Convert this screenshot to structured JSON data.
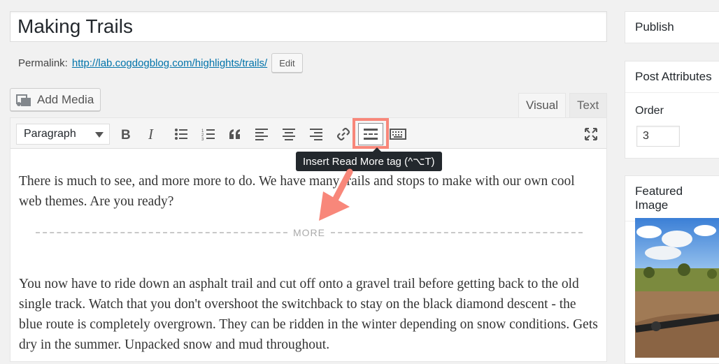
{
  "post": {
    "title": "Making Trails",
    "permalink_label": "Permalink:",
    "permalink_url": "http://lab.cogdogblog.com/highlights/trails/",
    "edit_label": "Edit"
  },
  "media": {
    "add_media_label": "Add Media"
  },
  "editor": {
    "tabs": {
      "visual": "Visual",
      "text": "Text"
    },
    "format_select": "Paragraph",
    "tooltip": "Insert Read More tag (^⌥T)",
    "more_label": "MORE",
    "paragraph1": "There is much to see, and more more to do. We have many trails and stops to make with our own cool web themes. Are you ready?",
    "paragraph2": "You now have to ride down an asphalt trail and cut off onto a gravel trail before getting back to the old single track. Watch that you don't overshoot the switchback to stay on the black diamond descent - the blue route is completely overgrown. They can be ridden in the winter depending on snow conditions. Gets dry in the summer. Unpacked snow and mud throughout."
  },
  "sidebar": {
    "publish_title": "Publish",
    "attributes_title": "Post Attributes",
    "order_label": "Order",
    "order_value": "3",
    "featured_title": "Featured Image"
  },
  "colors": {
    "highlight": "#f8877a",
    "link": "#0073aa",
    "tooltip_bg": "#23282d"
  }
}
